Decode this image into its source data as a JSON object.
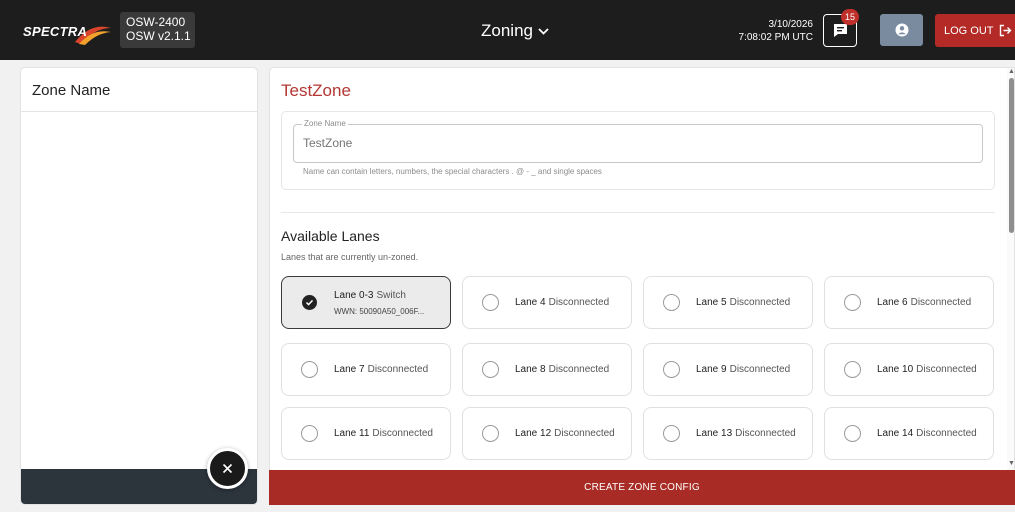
{
  "header": {
    "brand": "SPECTRA",
    "device_model": "OSW-2400",
    "device_version": "OSW v2.1.1",
    "nav_title": "Zoning",
    "date": "3/10/2026",
    "time": "7:08:02 PM UTC",
    "message_count": "15",
    "logout_label": "LOG OUT",
    "colors": {
      "bar": "#1d1d1d",
      "logout": "#b32a26",
      "user": "#7a8ba0",
      "badge": "#c0302b"
    }
  },
  "left_panel": {
    "header": "Zone Name"
  },
  "zone": {
    "title": "TestZone",
    "name_legend": "Zone Name",
    "name_placeholder": "TestZone",
    "name_help": "Name can contain letters, numbers, the special characters . @ - _ and single spaces"
  },
  "lanes": {
    "title": "Available Lanes",
    "subtitle": "Lanes that are currently un-zoned.",
    "items": [
      {
        "label": "Lane 0-3",
        "status": "Switch",
        "wwn": "WWN: 50090A50_006F...",
        "selected": true
      },
      {
        "label": "Lane 4",
        "status": "Disconnected",
        "selected": false
      },
      {
        "label": "Lane 5",
        "status": "Disconnected",
        "selected": false
      },
      {
        "label": "Lane 6",
        "status": "Disconnected",
        "selected": false
      },
      {
        "label": "Lane 7",
        "status": "Disconnected",
        "selected": false
      },
      {
        "label": "Lane 8",
        "status": "Disconnected",
        "selected": false
      },
      {
        "label": "Lane 9",
        "status": "Disconnected",
        "selected": false
      },
      {
        "label": "Lane 10",
        "status": "Disconnected",
        "selected": false
      },
      {
        "label": "Lane 11",
        "status": "Disconnected",
        "selected": false
      },
      {
        "label": "Lane 12",
        "status": "Disconnected",
        "selected": false
      },
      {
        "label": "Lane 13",
        "status": "Disconnected",
        "selected": false
      },
      {
        "label": "Lane 14",
        "status": "Disconnected",
        "selected": false
      }
    ]
  },
  "actions": {
    "create_label": "CREATE ZONE CONFIG",
    "accent": "#a92b25"
  },
  "icons": {
    "nav": "chevron-down-icon",
    "messages": "message-icon",
    "user": "user-icon",
    "logout": "logout-icon",
    "fab": "close-icon",
    "selected": "check-circle-icon"
  }
}
